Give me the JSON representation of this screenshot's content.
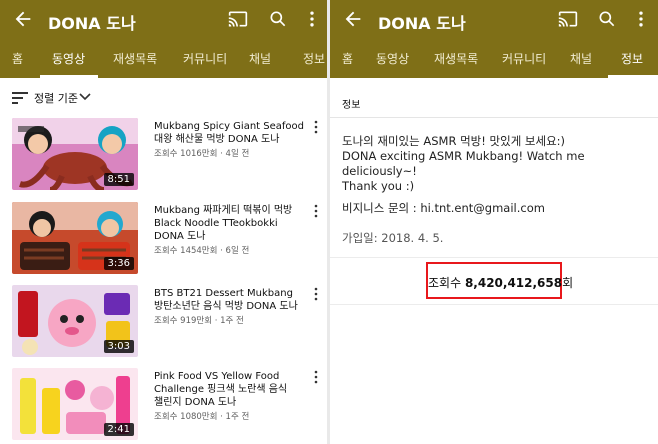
{
  "app": {
    "channel_title": "DONA 도나",
    "tabs": [
      "홈",
      "동영상",
      "재생목록",
      "커뮤니티",
      "채널",
      "정보"
    ],
    "bar_color": "#7f6f17"
  },
  "left": {
    "active_tab": "동영상",
    "sort_label": "정렬 기준",
    "videos": [
      {
        "title": "Mukbang Spicy Giant Seafood\n대왕 해산물 먹방 DONA 도나",
        "meta": "조회수 1016만회 · 4일 전",
        "duration": "8:51"
      },
      {
        "title": "Mukbang 짜파게티 떡볶이 먹방\nBlack Noodle TTeokbokki\nDONA 도나",
        "meta": "조회수 1454만회 · 6일 전",
        "duration": "3:36"
      },
      {
        "title": "BTS BT21 Dessert Mukbang\n방탄소년단 음식 먹방 DONA 도나",
        "meta": "조회수 919만회 · 1주 전",
        "duration": "3:03"
      },
      {
        "title": "Pink Food VS Yellow Food\nChallenge 핑크색 노란색 음식\n챌린지 DONA 도나",
        "meta": "조회수 1080만회 · 1주 전",
        "duration": "2:41"
      }
    ]
  },
  "right": {
    "active_tab": "정보",
    "about_heading": "정보",
    "description": "도나의 재미있는 ASMR 먹방! 맛있게 보세요:)\nDONA exciting ASMR Mukbang! Watch me deliciously~!\nThank you :)",
    "business": "비지니스 문의 : hi.tnt.ent@gmail.com",
    "joined": "가입일: 2018. 4. 5.",
    "views_prefix": "조회수 ",
    "views_count": "8,420,412,658",
    "views_suffix": "회",
    "highlight_color": "#e8181c"
  }
}
